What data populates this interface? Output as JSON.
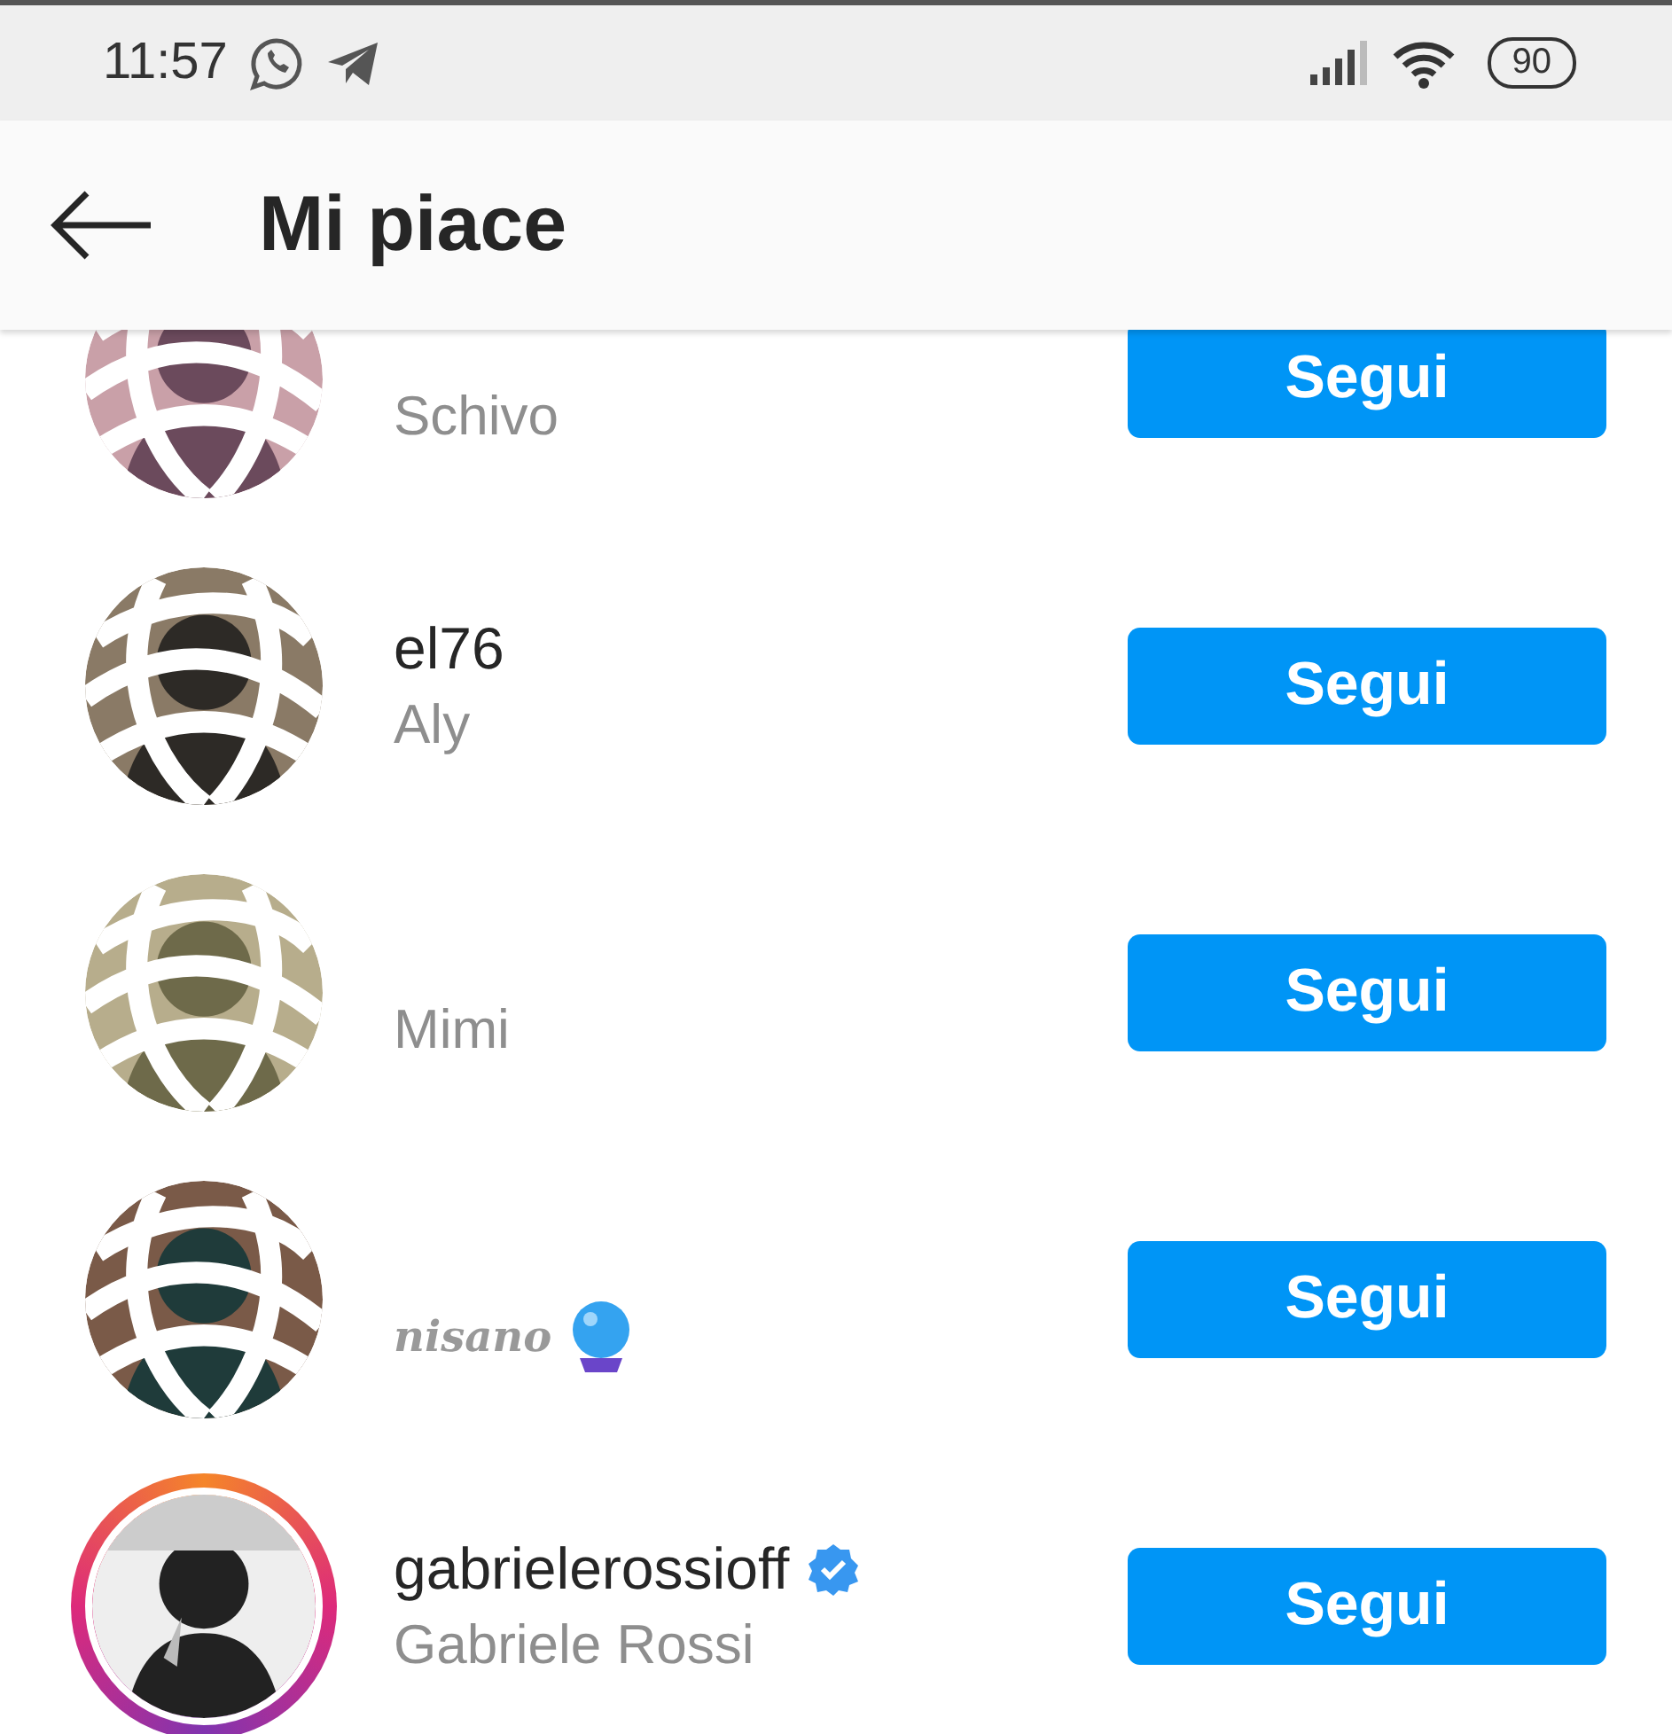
{
  "status_bar": {
    "time": "11:57",
    "battery": "90"
  },
  "header": {
    "title": "Mi piace"
  },
  "rows": [
    {
      "name": "Schivo",
      "verified": false,
      "orb": false,
      "story_ring": false,
      "button": "Segui"
    },
    {
      "username": "el76",
      "name": "Aly",
      "verified": false,
      "orb": false,
      "story_ring": false,
      "button": "Segui"
    },
    {
      "name": "Mimi",
      "verified": false,
      "orb": false,
      "story_ring": false,
      "button": "Segui"
    },
    {
      "name": "nisano",
      "verified": false,
      "orb": true,
      "story_ring": false,
      "button": "Segui"
    },
    {
      "username": "gabrielerossioff",
      "name": "Gabriele Rossi",
      "verified": true,
      "orb": false,
      "story_ring": true,
      "button": "Segui"
    }
  ]
}
